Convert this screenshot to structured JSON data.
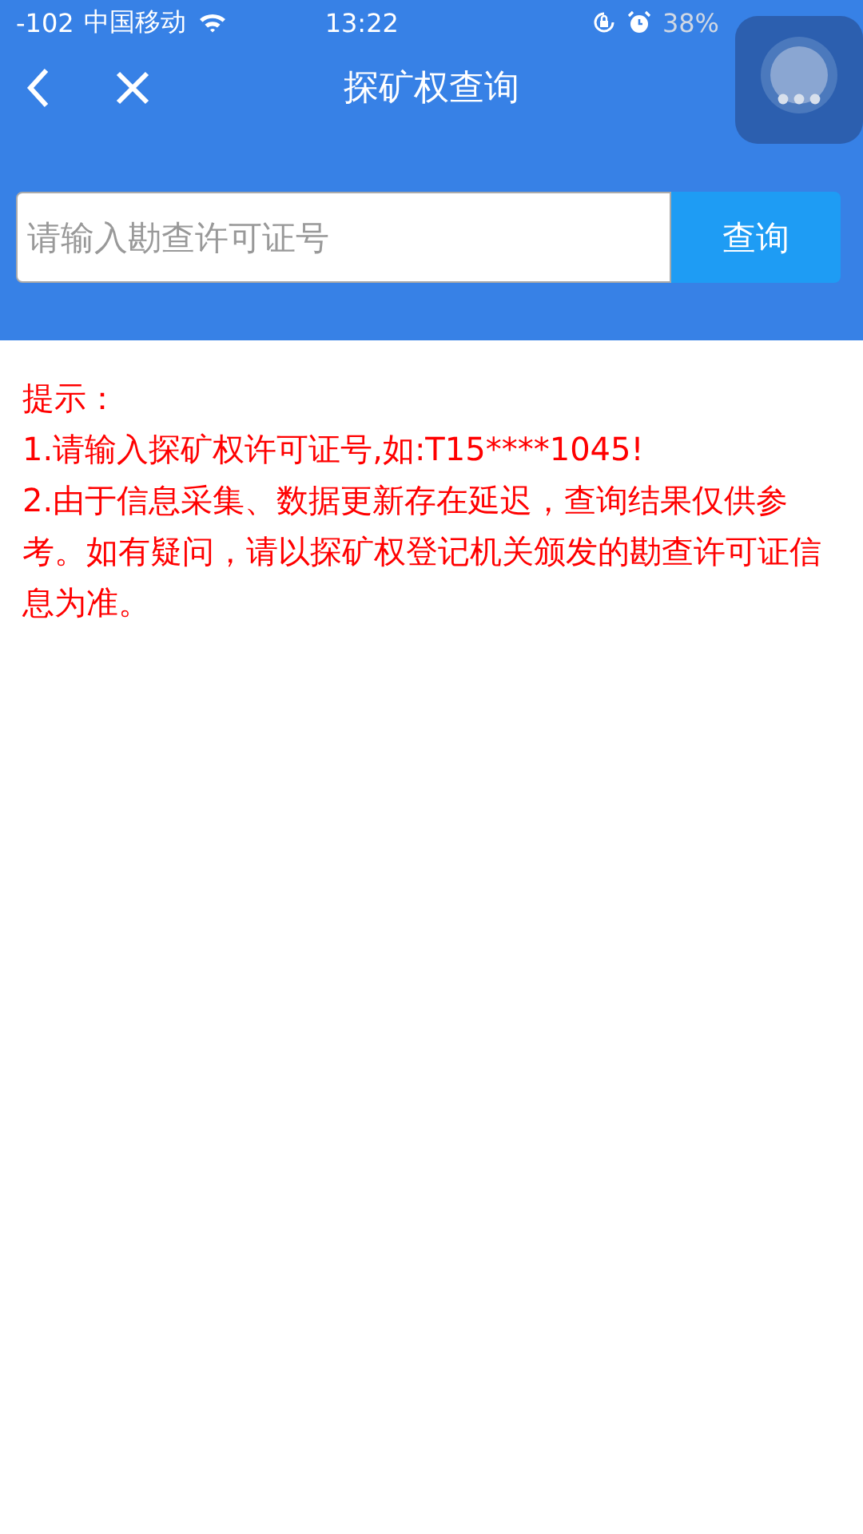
{
  "status_bar": {
    "signal": "-102",
    "carrier": "中国移动",
    "time": "13:22",
    "battery": "38%"
  },
  "nav": {
    "title": "探矿权查询"
  },
  "search": {
    "placeholder": "请输入勘查许可证号",
    "button": "查询"
  },
  "hints": [
    "提示：",
    "1.请输入探矿权许可证号,如:T15****1045!",
    "2.由于信息采集、数据更新存在延迟，查询结果仅供参考。如有疑问，请以探矿权登记机关颁发的勘查许可证信息为准。"
  ]
}
